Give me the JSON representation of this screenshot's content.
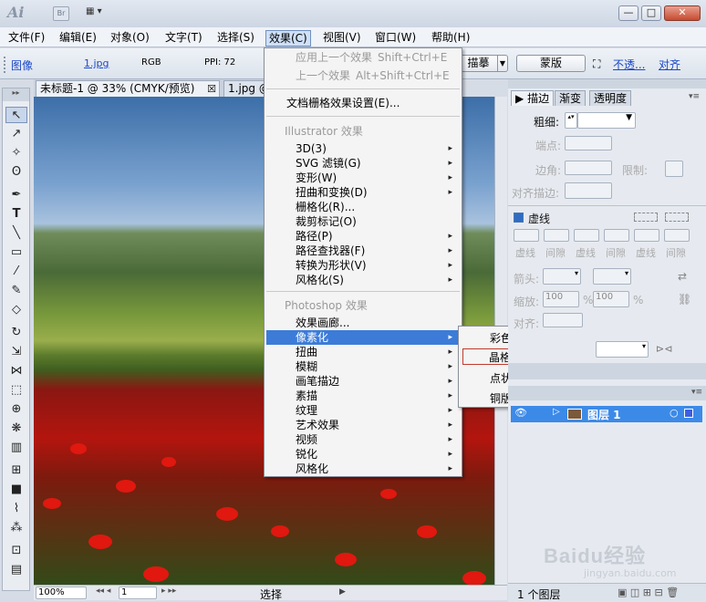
{
  "titlebar": {
    "app_logo": "Ai",
    "bridge": "Br",
    "controls": {
      "minimize": "—",
      "maximize": "□",
      "close": "✕"
    }
  },
  "menubar": [
    "文件(F)",
    "编辑(E)",
    "对象(O)",
    "文字(T)",
    "选择(S)",
    "效果(C)",
    "视图(V)",
    "窗口(W)",
    "帮助(H)"
  ],
  "control_bar": {
    "image_label": "图像",
    "file_link": "1.jpg",
    "color_mode": "RGB",
    "ppi": "PPI: 72",
    "trace_btn": "描摹",
    "mask_btn": "蒙版",
    "opacity_link": "不透...",
    "align_link": "对齐"
  },
  "doc_tabs": [
    {
      "label": "未标题-1 @ 33% (CMYK/预览)",
      "close": "☒"
    },
    {
      "label": "1.jpg @"
    }
  ],
  "effect_menu": {
    "items_top": [
      {
        "label": "应用上一个效果",
        "shortcut": "Shift+Ctrl+E"
      },
      {
        "label": "上一个效果",
        "shortcut": "Alt+Shift+Ctrl+E"
      }
    ],
    "raster_settings": "文档栅格效果设置(E)...",
    "illustrator_header": "Illustrator 效果",
    "illustrator_items": [
      "3D(3)",
      "SVG 滤镜(G)",
      "变形(W)",
      "扭曲和变换(D)",
      "栅格化(R)...",
      "裁剪标记(O)",
      "路径(P)",
      "路径查找器(F)",
      "转换为形状(V)",
      "风格化(S)"
    ],
    "photoshop_header": "Photoshop 效果",
    "photoshop_items": [
      "效果画廊...",
      "像素化",
      "扭曲",
      "模糊",
      "画笔描边",
      "素描",
      "纹理",
      "艺术效果",
      "视频",
      "锐化",
      "风格化"
    ]
  },
  "pixelate_submenu": [
    "彩色半调...",
    "晶格化...",
    "点状化...",
    "铜版雕刻..."
  ],
  "stroke_panel": {
    "tabs": [
      "描边",
      "渐变",
      "透明度"
    ],
    "weight": "粗细:",
    "cap": "端点:",
    "corner": "边角:",
    "limit": "限制:",
    "align": "对齐描边:",
    "dashed": "虚线",
    "dash_labels": [
      "虚线",
      "间隙",
      "虚线",
      "间隙",
      "虚线",
      "间隙"
    ],
    "arrow": "箭头:",
    "scale": "缩放:",
    "scale_val1": "100",
    "scale_val2": "100",
    "pct": "%",
    "align2": "对齐:"
  },
  "layers_panel": {
    "layer_name": "图层 1",
    "count": "1 个图层"
  },
  "status": {
    "zoom": "100%",
    "page": "1",
    "mode": "选择"
  },
  "watermark": {
    "text": "Baidu经验",
    "sub": "jingyan.baidu.com"
  },
  "colors": {
    "highlight": "#3c7cd8",
    "menu_bg": "#f4f4f4",
    "layer_select": "#3c8ae8"
  }
}
